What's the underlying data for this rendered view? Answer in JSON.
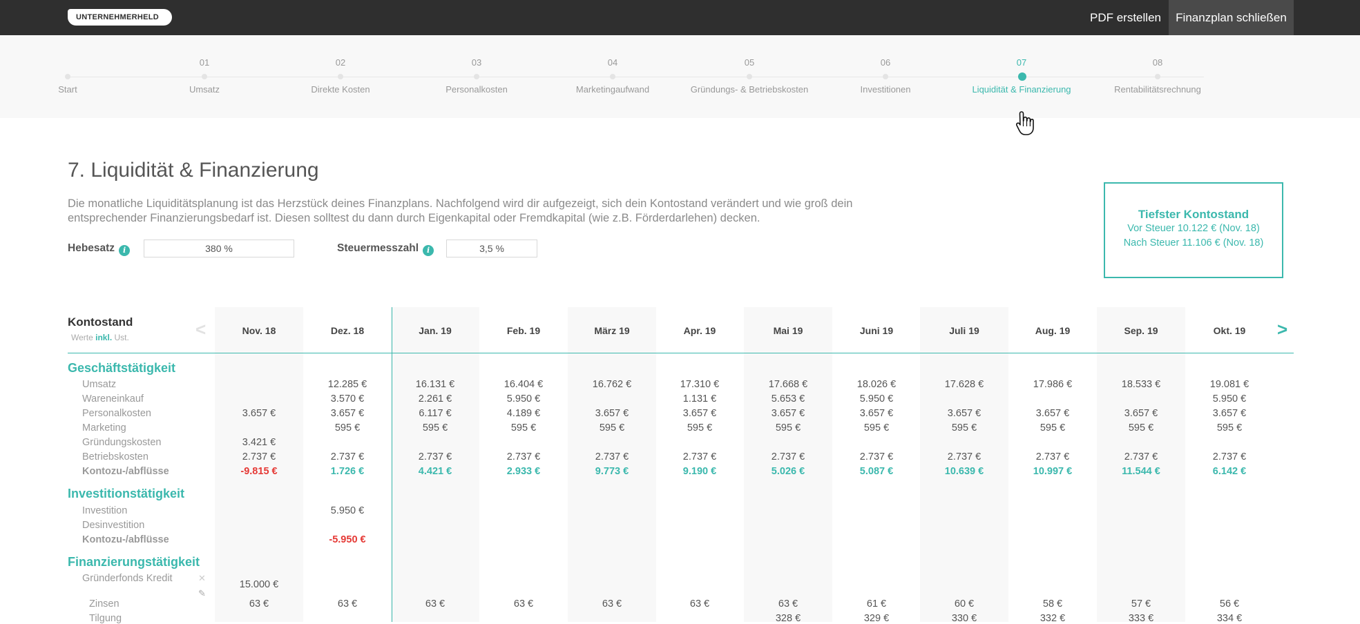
{
  "topbar": {
    "logo": "UNTERNEHMERHELD",
    "pdf_label": "PDF erstellen",
    "close_label": "Finanzplan schließen"
  },
  "stepper": [
    {
      "num": "",
      "label": "Start"
    },
    {
      "num": "01",
      "label": "Umsatz"
    },
    {
      "num": "02",
      "label": "Direkte Kosten"
    },
    {
      "num": "03",
      "label": "Personalkosten"
    },
    {
      "num": "04",
      "label": "Marketingaufwand"
    },
    {
      "num": "05",
      "label": "Gründungs- & Betriebskosten"
    },
    {
      "num": "06",
      "label": "Investitionen"
    },
    {
      "num": "07",
      "label": "Liquidität & Finanzierung",
      "active": true
    },
    {
      "num": "08",
      "label": "Rentabilitätsrechnung"
    }
  ],
  "page": {
    "title": "7. Liquidität & Finanzierung",
    "intro_line1": "Die monatliche Liquiditätsplanung ist das Herzstück deines Finanzplans. Nachfolgend wird dir aufgezeigt, sich dein Kontostand verändert und wie groß dein",
    "intro_line2": "entsprechender Finanzierungsbedarf ist. Diesen solltest du dann durch Eigenkapital oder Fremdkapital (wie z.B. Förderdarlehen) decken.",
    "hebesatz_label": "Hebesatz",
    "hebesatz_value": "380 %",
    "steuer_label": "Steuermesszahl",
    "steuer_value": "3,5 %"
  },
  "lowest_balance": {
    "title": "Tiefster Kontostand",
    "before_tax": "Vor Steuer 10.122 € (Nov. 18)",
    "after_tax": "Nach Steuer 11.106 € (Nov. 18)"
  },
  "table": {
    "title": "Kontostand",
    "sub_prefix": "Werte",
    "sub_inkl": "inkl.",
    "sub_suffix": "Ust.",
    "prev_arrow": "<",
    "next_arrow": ">",
    "months": [
      "Nov. 18",
      "Dez. 18",
      "Jan. 19",
      "Feb. 19",
      "März 19",
      "Apr. 19",
      "Mai 19",
      "Juni 19",
      "Juli 19",
      "Aug. 19",
      "Sep. 19",
      "Okt. 19"
    ],
    "sections": {
      "geschaeft": "Geschäftstätigkeit",
      "invest": "Investitionstätigkeit",
      "finanz": "Finanzierungstätigkeit"
    },
    "rows": {
      "umsatz": {
        "label": "Umsatz",
        "values": [
          "",
          "12.285 €",
          "16.131 €",
          "16.404 €",
          "16.762 €",
          "17.310 €",
          "17.668 €",
          "18.026 €",
          "17.628 €",
          "17.986 €",
          "18.533 €",
          "19.081 €"
        ]
      },
      "waren": {
        "label": "Wareneinkauf",
        "values": [
          "",
          "3.570 €",
          "2.261 €",
          "5.950 €",
          "",
          "1.131 €",
          "5.653 €",
          "5.950 €",
          "",
          "",
          "",
          "5.950 €"
        ]
      },
      "personal": {
        "label": "Personalkosten",
        "values": [
          "3.657 €",
          "3.657 €",
          "6.117 €",
          "4.189 €",
          "3.657 €",
          "3.657 €",
          "3.657 €",
          "3.657 €",
          "3.657 €",
          "3.657 €",
          "3.657 €",
          "3.657 €"
        ]
      },
      "marketing": {
        "label": "Marketing",
        "values": [
          "",
          "595 €",
          "595 €",
          "595 €",
          "595 €",
          "595 €",
          "595 €",
          "595 €",
          "595 €",
          "595 €",
          "595 €",
          "595 €"
        ]
      },
      "gruendung": {
        "label": "Gründungskosten",
        "values": [
          "3.421 €",
          "",
          "",
          "",
          "",
          "",
          "",
          "",
          "",
          "",
          "",
          ""
        ]
      },
      "betrieb": {
        "label": "Betriebskosten",
        "values": [
          "2.737 €",
          "2.737 €",
          "2.737 €",
          "2.737 €",
          "2.737 €",
          "2.737 €",
          "2.737 €",
          "2.737 €",
          "2.737 €",
          "2.737 €",
          "2.737 €",
          "2.737 €"
        ]
      },
      "konto1": {
        "label": "Kontozu-/abflüsse",
        "values": [
          "-9.815 €",
          "1.726 €",
          "4.421 €",
          "2.933 €",
          "9.773 €",
          "9.190 €",
          "5.026 €",
          "5.087 €",
          "10.639 €",
          "10.997 €",
          "11.544 €",
          "6.142 €"
        ]
      },
      "investition": {
        "label": "Investition",
        "values": [
          "",
          "5.950 €",
          "",
          "",
          "",
          "",
          "",
          "",
          "",
          "",
          "",
          ""
        ]
      },
      "desinvest": {
        "label": "Desinvestition",
        "values": [
          "",
          "",
          "",
          "",
          "",
          "",
          "",
          "",
          "",
          "",
          "",
          ""
        ]
      },
      "konto2": {
        "label": "Kontozu-/abflüsse",
        "values": [
          "",
          "-5.950 €",
          "",
          "",
          "",
          "",
          "",
          "",
          "",
          "",
          "",
          ""
        ]
      },
      "kredit": {
        "label": "Gründerfonds Kredit",
        "values": [
          "15.000 €",
          "",
          "",
          "",
          "",
          "",
          "",
          "",
          "",
          "",
          "",
          ""
        ]
      },
      "zinsen": {
        "label": "Zinsen",
        "values": [
          "63 €",
          "63 €",
          "63 €",
          "63 €",
          "63 €",
          "63 €",
          "63 €",
          "61 €",
          "60 €",
          "58 €",
          "57 €",
          "56 €"
        ]
      },
      "tilgung": {
        "label": "Tilgung",
        "values": [
          "",
          "",
          "",
          "",
          "",
          "",
          "328 €",
          "329 €",
          "330 €",
          "332 €",
          "333 €",
          "334 €"
        ]
      }
    },
    "remove_icon": "✕",
    "edit_icon": "✎"
  },
  "colors": {
    "accent": "#3bb8ad",
    "negative": "#e53935",
    "topbar": "#2f2f2f"
  }
}
